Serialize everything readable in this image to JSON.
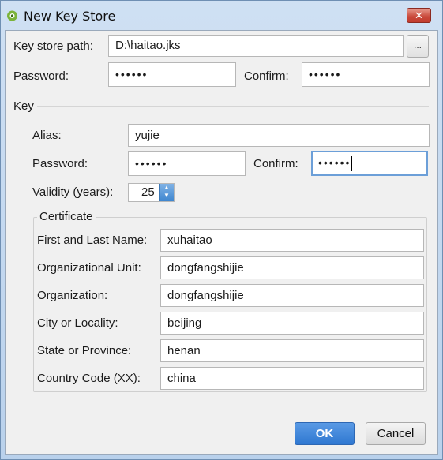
{
  "window": {
    "title": "New Key Store",
    "close_glyph": "✕"
  },
  "keystore": {
    "path_label": "Key store path:",
    "path_value": "D:\\haitao.jks",
    "browse_label": "...",
    "password_label": "Password:",
    "password_value": "••••••",
    "confirm_label": "Confirm:",
    "confirm_value": "••••••"
  },
  "key": {
    "section_label": "Key",
    "alias_label": "Alias:",
    "alias_value": "yujie",
    "password_label": "Password:",
    "password_value": "••••••",
    "confirm_label": "Confirm:",
    "confirm_value": "••••••",
    "validity_label": "Validity (years):",
    "validity_value": "25"
  },
  "certificate": {
    "title": "Certificate",
    "fields": [
      {
        "label": "First and Last Name:",
        "value": "xuhaitao"
      },
      {
        "label": "Organizational Unit:",
        "value": "dongfangshijie"
      },
      {
        "label": "Organization:",
        "value": "dongfangshijie"
      },
      {
        "label": "City or Locality:",
        "value": "beijing"
      },
      {
        "label": "State or Province:",
        "value": "henan"
      },
      {
        "label": "Country Code (XX):",
        "value": "china"
      }
    ]
  },
  "buttons": {
    "ok": "OK",
    "cancel": "Cancel"
  },
  "colors": {
    "ok_button": "#2f78d1",
    "focus_border": "#6c9fd8",
    "titlebar": "#c3d8ef"
  },
  "icons": {
    "app": "android-studio-icon",
    "close": "close-icon",
    "spin": "spinner-arrows-icon"
  }
}
